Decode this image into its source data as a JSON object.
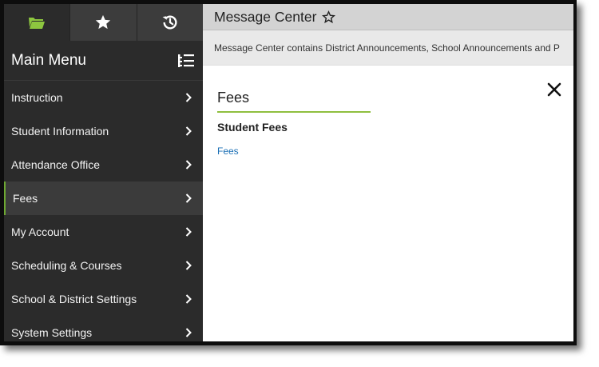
{
  "sidebar": {
    "tabs": [
      {
        "name": "folder-icon",
        "active": true
      },
      {
        "name": "star-icon",
        "active": false
      },
      {
        "name": "history-icon",
        "active": false
      }
    ],
    "title": "Main Menu",
    "items": [
      {
        "label": "Instruction"
      },
      {
        "label": "Student Information"
      },
      {
        "label": "Attendance Office"
      },
      {
        "label": "Fees",
        "active": true
      },
      {
        "label": "My Account"
      },
      {
        "label": "Scheduling & Courses"
      },
      {
        "label": "School & District Settings"
      },
      {
        "label": "System Settings"
      }
    ]
  },
  "header": {
    "title": "Message Center"
  },
  "banner": {
    "text": "Message Center contains District Announcements, School Announcements and P"
  },
  "flyout": {
    "title": "Fees",
    "subtitle": "Student Fees",
    "link": "Fees"
  },
  "colors": {
    "accent": "#6ea832",
    "link": "#1a6fb5",
    "sidebar_bg": "#2b2b2b"
  }
}
